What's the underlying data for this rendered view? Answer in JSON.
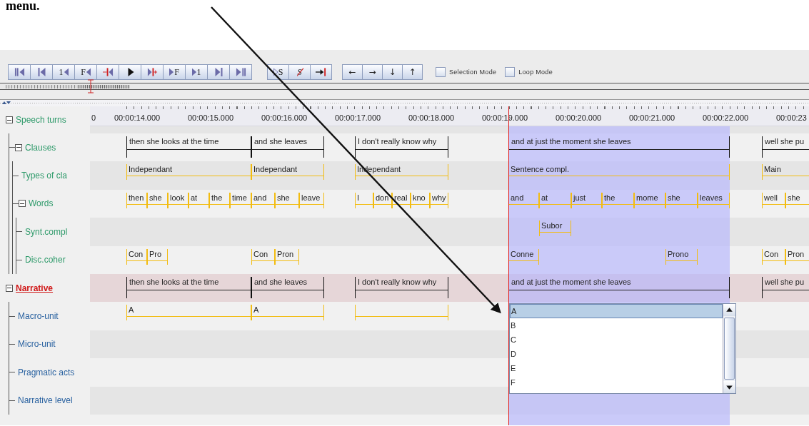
{
  "heading": "menu.",
  "toolbar": {
    "groups": [
      [
        {
          "kind": "bars-left"
        },
        {
          "kind": "bar-left"
        },
        {
          "kind": "label-left",
          "label": "1"
        },
        {
          "kind": "label-left",
          "label": "F"
        },
        {
          "kind": "red-bar-left"
        },
        {
          "kind": "play"
        },
        {
          "kind": "right-red-bar-plus"
        },
        {
          "kind": "right-label",
          "label": "F"
        },
        {
          "kind": "right-label",
          "label": "1"
        },
        {
          "kind": "right-bar"
        },
        {
          "kind": "right-bars"
        }
      ],
      [
        {
          "kind": "hollow-right-label",
          "label": "S"
        },
        {
          "kind": "struck-label",
          "label": "S"
        },
        {
          "kind": "arrow-red-bar"
        }
      ],
      [
        {
          "kind": "text",
          "label": "←"
        },
        {
          "kind": "text",
          "label": "→"
        },
        {
          "kind": "text",
          "label": "↓"
        },
        {
          "kind": "text",
          "label": "↑"
        }
      ]
    ],
    "checkboxes": [
      {
        "label": "Selection Mode",
        "checked": false
      },
      {
        "label": "Loop Mode",
        "checked": false
      }
    ]
  },
  "ruler": {
    "labels": [
      "0",
      "00:00:14.000",
      "00:00:15.000",
      "00:00:16.000",
      "00:00:17.000",
      "00:00:18.000",
      "00:00:19.000",
      "00:00:20.000",
      "00:00:21.000",
      "00:00:22.000",
      "00:00:23"
    ]
  },
  "tiers": [
    {
      "name": "Speech turns",
      "color": "#2e9a6a",
      "selected": false,
      "expanded": true,
      "children": [
        {
          "name": "Clauses",
          "color": "#2e9a6a",
          "selected": false,
          "expanded": true,
          "kind": "time-aligned",
          "annotations": [
            {
              "text": "then she looks at the time"
            },
            {
              "text": "and she leaves"
            },
            {
              "text": "I don't really know why"
            },
            {
              "text": "and at just the moment she leaves"
            },
            {
              "text": "well she pu"
            }
          ],
          "children": [
            {
              "name": "Types of cla",
              "color": "#2e9a6a",
              "selected": false,
              "kind": "dependent",
              "annotations": [
                {
                  "text": "Independant"
                },
                {
                  "text": "Independant"
                },
                {
                  "text": "Independant"
                },
                {
                  "text": "Sentence compl."
                },
                {
                  "text": "Main"
                }
              ]
            },
            {
              "name": "Words",
              "color": "#2e9a6a",
              "selected": false,
              "expanded": true,
              "kind": "dependent",
              "annotations": [
                {
                  "text": "then"
                },
                {
                  "text": "she"
                },
                {
                  "text": "look"
                },
                {
                  "text": "at"
                },
                {
                  "text": "the"
                },
                {
                  "text": "time"
                },
                {
                  "text": "and"
                },
                {
                  "text": "she"
                },
                {
                  "text": "leave"
                },
                {
                  "text": "I"
                },
                {
                  "text": "don"
                },
                {
                  "text": "real"
                },
                {
                  "text": "kno"
                },
                {
                  "text": "why"
                },
                {
                  "text": "and"
                },
                {
                  "text": "at"
                },
                {
                  "text": "just"
                },
                {
                  "text": "the"
                },
                {
                  "text": "mome"
                },
                {
                  "text": "she"
                },
                {
                  "text": "leaves"
                },
                {
                  "text": "well"
                },
                {
                  "text": "she"
                }
              ],
              "children": [
                {
                  "name": "Synt.compl",
                  "color": "#2e9a6a",
                  "selected": false,
                  "kind": "dependent",
                  "annotations": [
                    {
                      "text": "Subor"
                    }
                  ]
                },
                {
                  "name": "Disc.coher",
                  "color": "#2e9a6a",
                  "selected": false,
                  "kind": "dependent",
                  "annotations": [
                    {
                      "text": "Con"
                    },
                    {
                      "text": "Pro"
                    },
                    {
                      "text": "Con"
                    },
                    {
                      "text": "Pron"
                    },
                    {
                      "text": "Conne"
                    },
                    {
                      "text": "Prono"
                    },
                    {
                      "text": "Con"
                    },
                    {
                      "text": "Pron"
                    }
                  ]
                }
              ]
            }
          ]
        }
      ]
    },
    {
      "name": "Narrative",
      "color": "#d01818",
      "selected": true,
      "expanded": true,
      "kind": "time-aligned",
      "annotations": [
        {
          "text": "then she looks at the time"
        },
        {
          "text": "and she leaves"
        },
        {
          "text": "I don't really know why"
        },
        {
          "text": "and at just the moment she leaves"
        },
        {
          "text": "well she pu"
        }
      ],
      "children": [
        {
          "name": "Macro-unit",
          "color": "#2a62a0",
          "selected": false,
          "kind": "dependent",
          "annotations": [
            {
              "text": "A"
            },
            {
              "text": "A"
            },
            {
              "kind": "empty"
            }
          ]
        },
        {
          "name": "Micro-unit",
          "color": "#2a62a0",
          "selected": false
        },
        {
          "name": "Pragmatic acts",
          "color": "#2a62a0",
          "selected": false
        },
        {
          "name": "Narrative level",
          "color": "#2a62a0",
          "selected": false
        }
      ]
    }
  ],
  "value_list": {
    "items": [
      {
        "text": "A",
        "selected": true
      },
      {
        "text": "B",
        "selected": false
      },
      {
        "text": "C",
        "selected": false
      },
      {
        "text": "D",
        "selected": false
      },
      {
        "text": "E",
        "selected": false
      },
      {
        "text": "F",
        "selected": false
      }
    ]
  }
}
